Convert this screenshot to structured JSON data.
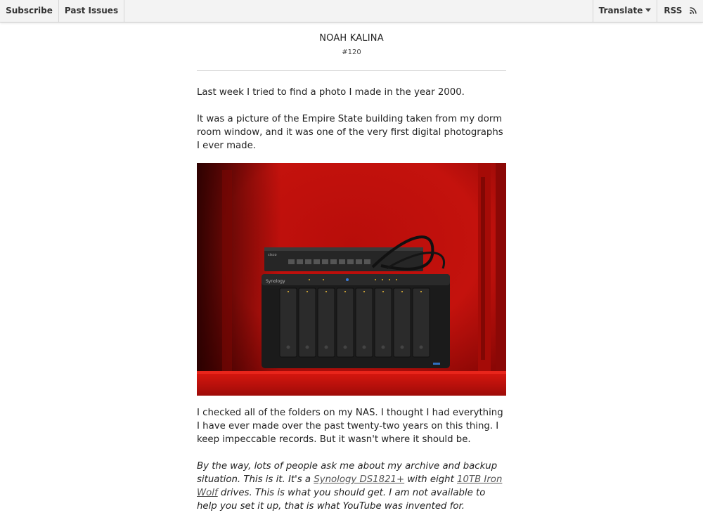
{
  "nav": {
    "subscribe": "Subscribe",
    "past_issues": "Past Issues",
    "translate": "Translate",
    "rss": "RSS"
  },
  "header": {
    "name": "NOAH KALINA",
    "issue": "#120"
  },
  "body": {
    "p1": "Last week I tried to find a photo I made in the year 2000.",
    "p2": "It was a picture of the Empire State building taken from my dorm room window, and it was one of the very first digital photographs I ever made.",
    "p3": "I checked all of the folders on my NAS. I thought I had everything I have ever made over the past twenty-two years on this thing. I keep impeccable records. But it wasn't where it should be.",
    "p4": {
      "part1": "By the way, lots of people ask me about my archive and backup situation. This is it. It's a ",
      "link1": "Synology DS1821+",
      "part2": " with eight ",
      "link2": "10TB Iron Wolf",
      "part3": " drives. This is what you should get. I am not available to help you set it up, that is what YouTube was invented for."
    }
  },
  "photo": {
    "brand_text": "Synology",
    "cisco_text": "cisco",
    "colors": {
      "red": "#c4120d",
      "dark_red": "#5a0000",
      "device": "#1b1b1b"
    }
  }
}
